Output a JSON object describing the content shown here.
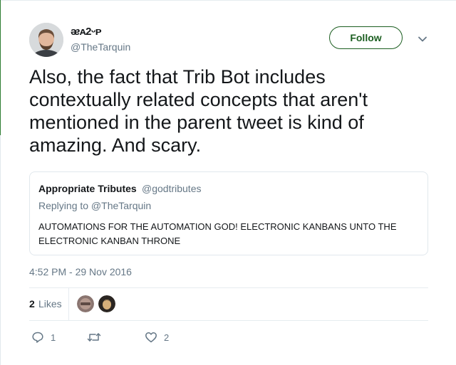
{
  "user": {
    "display_name": "ᴂᴀ2ᵕᴘ",
    "handle": "@TheTarquin"
  },
  "header": {
    "follow_label": "Follow"
  },
  "tweet": {
    "text": "Also, the fact that Trib Bot includes contextually related concepts that aren't mentioned in the parent tweet is kind of amazing. And scary.",
    "timestamp": "4:52 PM - 29 Nov 2016"
  },
  "quote": {
    "name": "Appropriate Tributes",
    "handle": "@godtributes",
    "replying_to": "Replying to @TheTarquin",
    "text": "AUTOMATIONS FOR THE AUTOMATION GOD! ELECTRONIC KANBANS UNTO THE ELECTRONIC KANBAN THRONE"
  },
  "stats": {
    "likes_count": "2",
    "likes_label": "Likes"
  },
  "actions": {
    "reply_count": "1",
    "retweet_count": "",
    "like_count": "2"
  },
  "colors": {
    "follow_accent": "#1b5e20",
    "muted_text": "#657786"
  },
  "icons": [
    "chevron-down-icon",
    "reply-icon",
    "retweet-icon",
    "heart-icon"
  ]
}
